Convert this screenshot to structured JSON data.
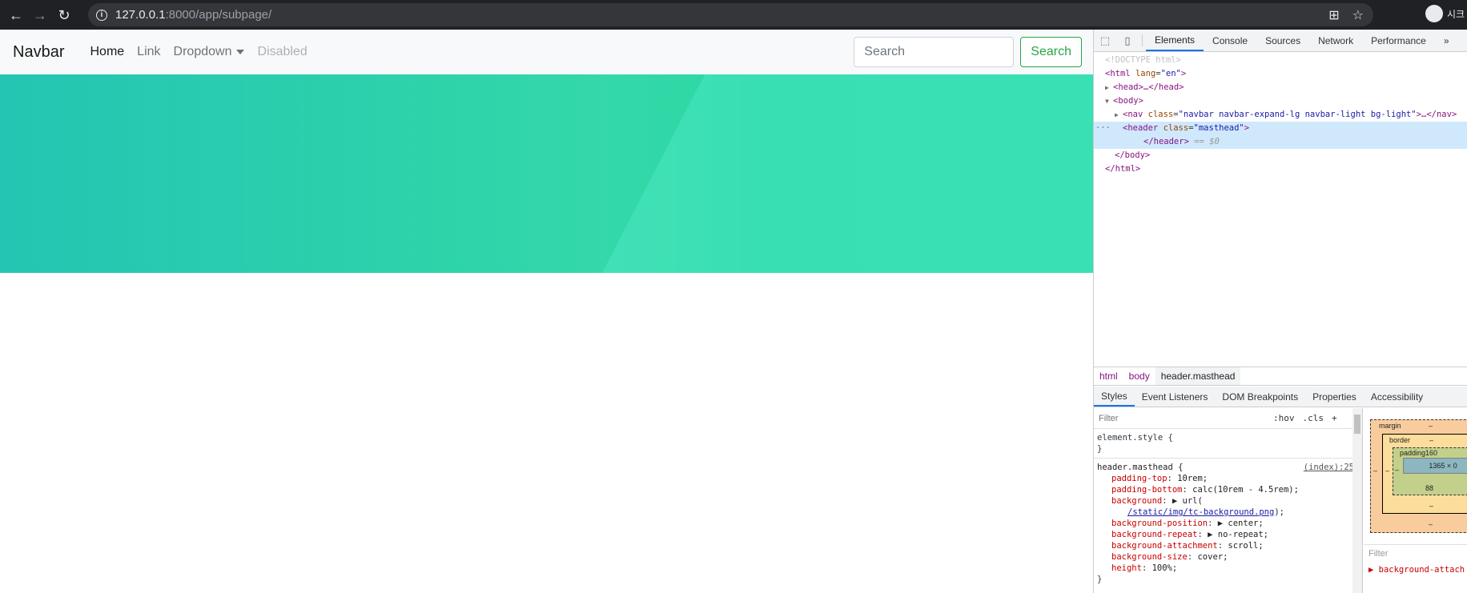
{
  "browser": {
    "url_host": "127.0.0.1",
    "url_rest": ":8000/app/subpage/",
    "profile_label": "시크"
  },
  "navbar": {
    "brand": "Navbar",
    "links": [
      "Home",
      "Link",
      "Dropdown",
      "Disabled"
    ],
    "search_placeholder": "Search",
    "search_button": "Search"
  },
  "devtools": {
    "tabs": [
      "Elements",
      "Console",
      "Sources",
      "Network",
      "Performance"
    ],
    "more": "»",
    "dom": {
      "doctype": "<!DOCTYPE html>",
      "html_open": "<html",
      "lang_attr": "lang",
      "lang_val": "\"en\"",
      "head": "<head>…</head>",
      "body_open": "<body>",
      "nav_tag": "<nav",
      "nav_class_attr": "class",
      "nav_class_val": "\"navbar navbar-expand-lg navbar-light bg-light\"",
      "nav_close": ">…</nav>",
      "header_open": "<header",
      "header_class_attr": "class",
      "header_class_val": "\"masthead\"",
      "header_close": "</header>",
      "selected_marker": "== $0",
      "body_close": "</body>",
      "html_close": "</html>",
      "ellipsis": "···"
    },
    "breadcrumbs": [
      "html",
      "body",
      "header.masthead"
    ],
    "subtabs": [
      "Styles",
      "Event Listeners",
      "DOM Breakpoints",
      "Properties",
      "Accessibility"
    ],
    "styles": {
      "filter_placeholder": "Filter",
      "hov": ":hov",
      "cls": ".cls",
      "plus": "+",
      "element_style": "element.style {",
      "close_brace": "}",
      "selector": "header.masthead {",
      "source": "(index):25",
      "props": [
        {
          "name": "padding-top",
          "value": "10rem;"
        },
        {
          "name": "padding-bottom",
          "value": "calc(10rem - 4.5rem);"
        },
        {
          "name": "background",
          "value": "▶ url("
        },
        {
          "name": "background-position",
          "value": "▶ center;"
        },
        {
          "name": "background-repeat",
          "value": "▶ no-repeat;"
        },
        {
          "name": "background-attachment",
          "value": "scroll;"
        },
        {
          "name": "background-size",
          "value": "cover;"
        },
        {
          "name": "height",
          "value": "100%;"
        }
      ],
      "bg_url": "/static/img/tc-background.png",
      "bg_url_tail": ");"
    },
    "boxmodel": {
      "margin_label": "margin",
      "border_label": "border",
      "padding_label": "padding160",
      "content_size": "1365 × 0",
      "padding_bottom": "88",
      "dash": "–",
      "filter": "Filter",
      "computed_prop": "▶ background-attach"
    }
  }
}
